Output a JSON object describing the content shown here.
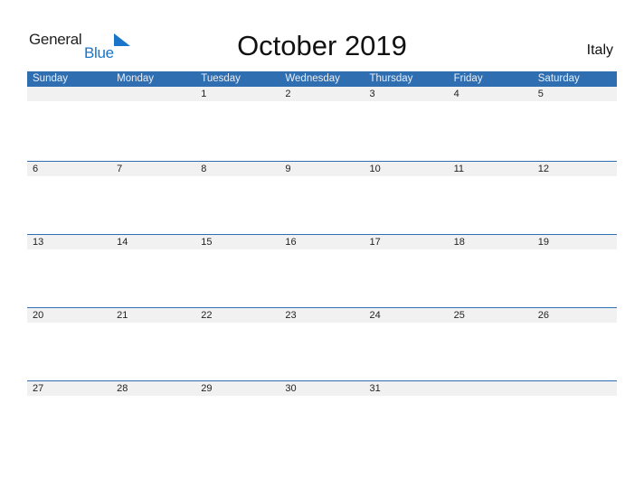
{
  "logo": {
    "word1": "General",
    "word2": "Blue"
  },
  "title": "October 2019",
  "country": "Italy",
  "weekdays": [
    "Sunday",
    "Monday",
    "Tuesday",
    "Wednesday",
    "Thursday",
    "Friday",
    "Saturday"
  ],
  "weeks": [
    [
      "",
      "",
      "1",
      "2",
      "3",
      "4",
      "5"
    ],
    [
      "6",
      "7",
      "8",
      "9",
      "10",
      "11",
      "12"
    ],
    [
      "13",
      "14",
      "15",
      "16",
      "17",
      "18",
      "19"
    ],
    [
      "20",
      "21",
      "22",
      "23",
      "24",
      "25",
      "26"
    ],
    [
      "27",
      "28",
      "29",
      "30",
      "31",
      "",
      ""
    ]
  ],
  "colors": {
    "accent": "#2f6fb1",
    "strip": "#f1f1f1",
    "logo_blue": "#1a75c9"
  }
}
